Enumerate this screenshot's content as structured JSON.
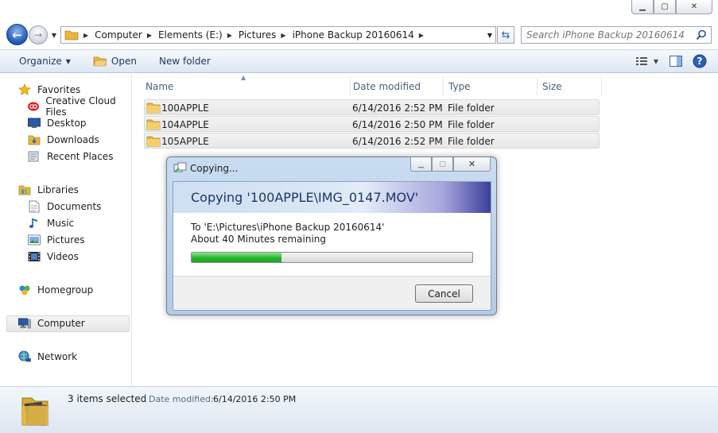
{
  "window": {
    "minimize_glyph": "▁",
    "maximize_glyph": "▢",
    "close_glyph": "✕"
  },
  "address": {
    "crumbs": [
      "Computer",
      "Elements (E:)",
      "Pictures",
      "iPhone Backup 20160614"
    ]
  },
  "search": {
    "placeholder": "Search iPhone Backup 20160614"
  },
  "toolbar": {
    "organize": "Organize",
    "open": "Open",
    "new_folder": "New folder"
  },
  "nav": {
    "favorites": "Favorites",
    "creative_cloud": "Creative Cloud Files",
    "desktop": "Desktop",
    "downloads": "Downloads",
    "recent_places": "Recent Places",
    "libraries": "Libraries",
    "documents": "Documents",
    "music": "Music",
    "pictures": "Pictures",
    "videos": "Videos",
    "homegroup": "Homegroup",
    "computer": "Computer",
    "network": "Network"
  },
  "columns": {
    "name": "Name",
    "date_modified": "Date modified",
    "type": "Type",
    "size": "Size"
  },
  "files": [
    {
      "name": "100APPLE",
      "date": "6/14/2016 2:52 PM",
      "type": "File folder",
      "size": ""
    },
    {
      "name": "104APPLE",
      "date": "6/14/2016 2:50 PM",
      "type": "File folder",
      "size": ""
    },
    {
      "name": "105APPLE",
      "date": "6/14/2016 2:52 PM",
      "type": "File folder",
      "size": ""
    }
  ],
  "status": {
    "count": "3 items selected",
    "date_label": "Date modified:",
    "date_value": "6/14/2016 2:50 PM"
  },
  "dialog": {
    "title": "Copying...",
    "heading": "Copying '100APPLE\\IMG_0147.MOV'",
    "destination": "To 'E:\\Pictures\\iPhone Backup 20160614'",
    "remaining": "About 40 Minutes remaining",
    "progress": 0.32,
    "cancel": "Cancel"
  },
  "colors": {
    "accent": "#1d55b3",
    "progress_green": "#27b32c",
    "folder_yellow": "#e8b73a"
  }
}
